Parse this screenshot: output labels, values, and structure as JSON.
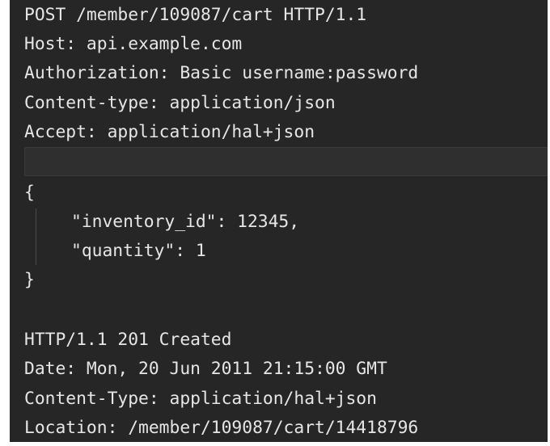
{
  "request": {
    "request_line": "POST /member/109087/cart HTTP/1.1",
    "host": "Host: api.example.com",
    "authorization": "Authorization: Basic username:password",
    "content_type": "Content-type: application/json",
    "accept": "Accept: application/hal+json"
  },
  "body": {
    "open_brace": "{",
    "line1": "\"inventory_id\": 12345,",
    "line2": "\"quantity\": 1",
    "close_brace": "}"
  },
  "response": {
    "status_line": "HTTP/1.1 201 Created",
    "date": "Date: Mon, 20 Jun 2011 21:15:00 GMT",
    "content_type": "Content-Type: application/hal+json",
    "location": "Location: /member/109087/cart/14418796"
  },
  "colors": {
    "background": "#262626",
    "text": "#e6e6e6",
    "current_line": "#2f2f2f"
  }
}
